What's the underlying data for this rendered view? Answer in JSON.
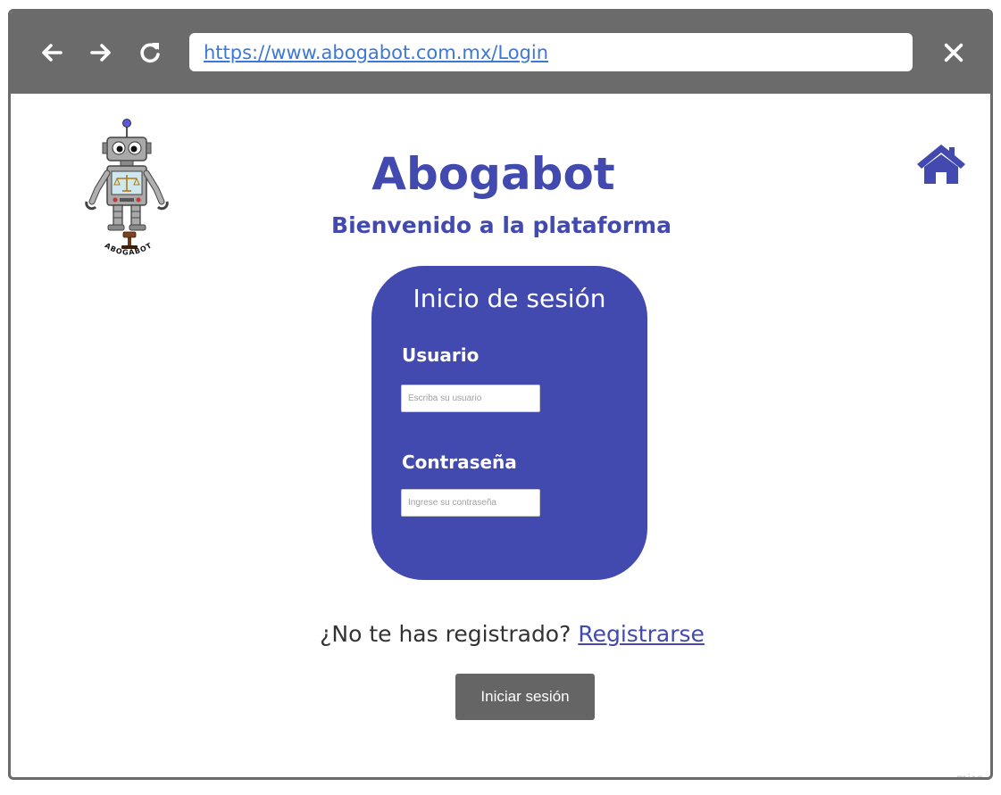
{
  "browser": {
    "url": "https://www.abogabot.com.mx/Login",
    "back_icon": "arrow-left-icon",
    "forward_icon": "arrow-right-icon",
    "reload_icon": "reload-icon",
    "close_icon": "close-icon"
  },
  "header": {
    "logo_text": "ABOGABOT",
    "title": "Abogabot",
    "subtitle": "Bienvenido a la plataforma",
    "home_icon": "home-icon"
  },
  "login_card": {
    "title": "Inicio de sesión",
    "username_label": "Usuario",
    "username_placeholder": "Escriba su usuario",
    "password_label": "Contraseña",
    "password_placeholder": "Ingrese su contraseña"
  },
  "register": {
    "prompt": "¿No te has registrado?",
    "link": "Registrarse"
  },
  "actions": {
    "submit_label": "Iniciar sesión"
  },
  "watermark": "miro",
  "colors": {
    "toolbar": "#6b6b6b",
    "brand": "#424aaf",
    "url": "#3b78d8",
    "button": "#656565"
  }
}
